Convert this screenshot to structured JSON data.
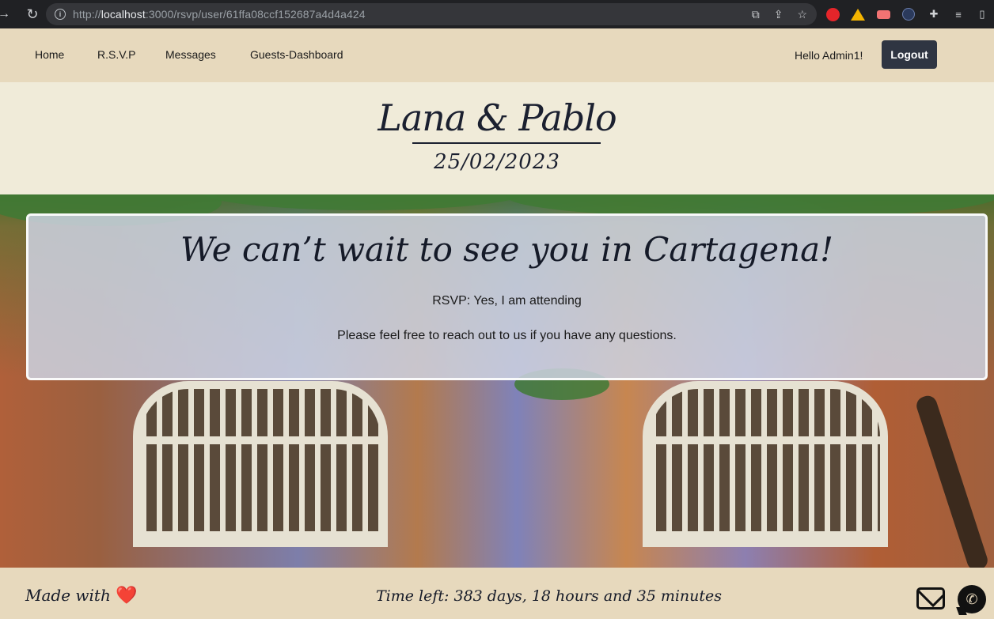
{
  "browser": {
    "url_prefix": "http://",
    "url_host": "localhost",
    "url_rest": ":3000/rsvp/user/61ffa08ccf152687a4d4a424"
  },
  "navbar": {
    "links": [
      "Home",
      "R.S.V.P",
      "Messages",
      "Guests-Dashboard"
    ],
    "greeting": "Hello Admin1!",
    "logout_label": "Logout"
  },
  "header": {
    "couple": "Lana & Pablo",
    "date": "25/02/2023"
  },
  "card": {
    "title": "We can’t wait to see you in Cartagena!",
    "rsvp_status": "RSVP: Yes, I am attending",
    "message": "Please feel free to reach out to us if you have any questions."
  },
  "footer": {
    "made_with": "Made with",
    "heart": "❤️",
    "time_left": "Time left: 383 days, 18 hours and 35 minutes"
  },
  "colors": {
    "navbar_bg": "#e7d9bd",
    "header_bg": "#f0ebd9",
    "logout_bg": "#2f3542",
    "text_dark": "#151a28"
  }
}
